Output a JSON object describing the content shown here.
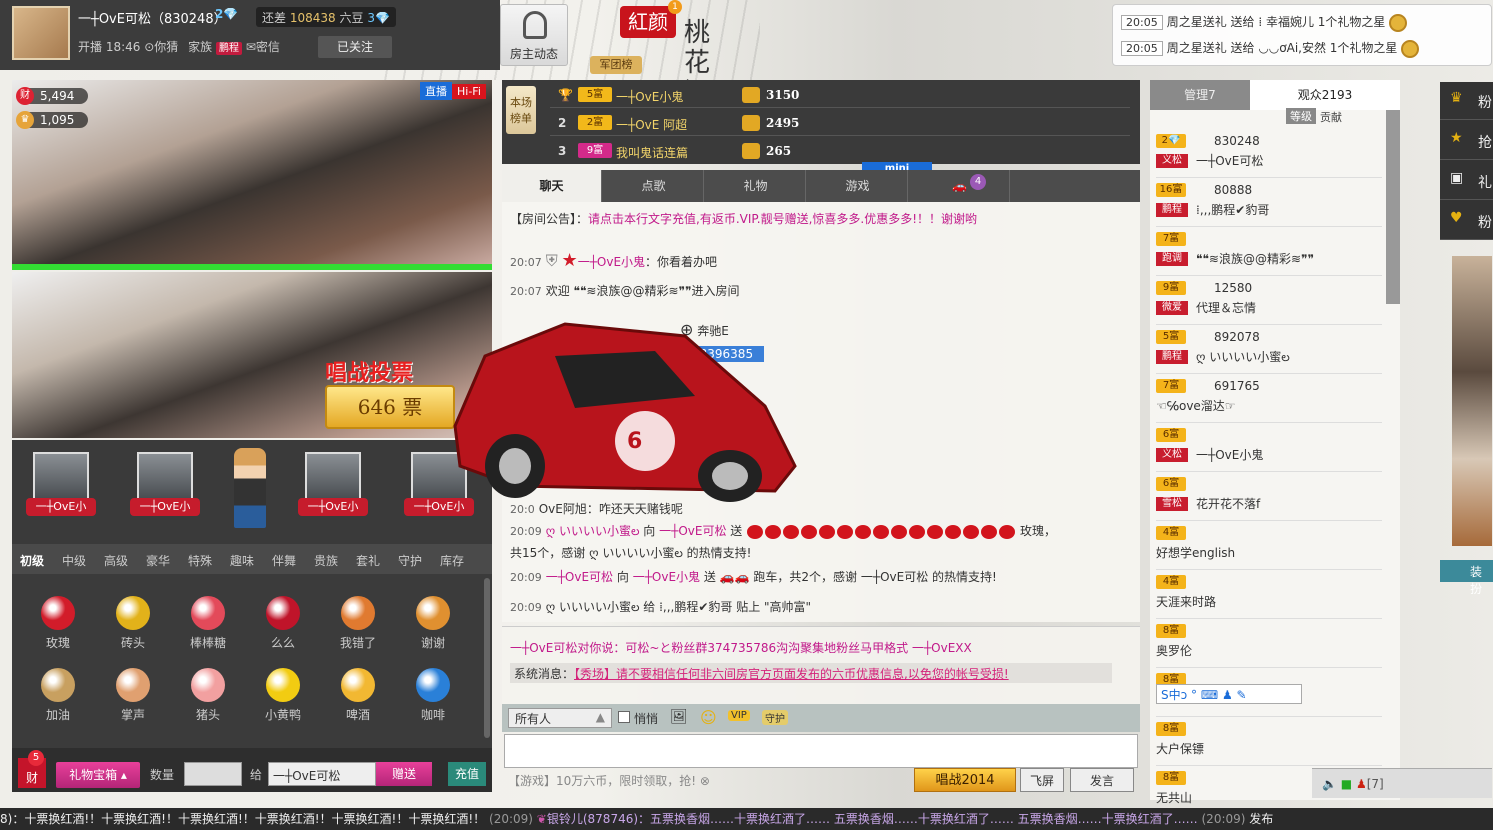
{
  "header": {
    "host_name": "一┼OvE可松（830248）",
    "host_level": "2💎",
    "diff_label": "还差",
    "diff_value": "108438",
    "diff_unit": "六豆",
    "diff_level": "3💎",
    "start_label": "开播 18:46",
    "location": "你猜",
    "family_label": "家族",
    "family_tag": "鹏程",
    "private_msg": "密信",
    "followed": "已关注",
    "host_dynamic": "房主动态",
    "red_logo": "紅颜",
    "red_logo_badge": "1",
    "army_label": "军团榜",
    "brand_text": "桃花源"
  },
  "notify": [
    {
      "time": "20:05",
      "text": "周之星送礼 送给 ⁞ 幸福婉儿 1个礼物之星"
    },
    {
      "time": "20:05",
      "text": "周之星送礼 送给 ◡◡ơAi,安然 1个礼物之星"
    }
  ],
  "video": {
    "wealth": "5,494",
    "wealth_icon": "财",
    "fans": "1,095",
    "live": "直播",
    "hifi": "Hi-Fi",
    "vote_title": "唱战投票",
    "vote_count": "646 票"
  },
  "seats": [
    "一┼OvE小",
    "一┼OvE小",
    "一┼OvE小",
    "一┼OvE小"
  ],
  "gift_tabs": [
    "初级",
    "中级",
    "高级",
    "豪华",
    "特殊",
    "趣味",
    "伴舞",
    "贵族",
    "套礼",
    "守护",
    "库存"
  ],
  "gifts": [
    {
      "name": "玫瑰",
      "color": "#d21c2a"
    },
    {
      "name": "砖头",
      "color": "#e2b21a"
    },
    {
      "name": "棒棒糖",
      "color": "#e34a5a"
    },
    {
      "name": "么么",
      "color": "#c0142a"
    },
    {
      "name": "我错了",
      "color": "#e07a30"
    },
    {
      "name": "谢谢",
      "color": "#e09030"
    },
    {
      "name": "加油",
      "color": "#c8a060"
    },
    {
      "name": "掌声",
      "color": "#e0a070"
    },
    {
      "name": "猪头",
      "color": "#f2a0a0"
    },
    {
      "name": "小黄鸭",
      "color": "#f2cc12"
    },
    {
      "name": "啤酒",
      "color": "#f2b832"
    },
    {
      "name": "咖啡",
      "color": "#2a80d8"
    }
  ],
  "giftbar": {
    "wealth": "财",
    "wealth_badge": "5",
    "box": "礼物宝箱",
    "qty_label": "数量",
    "to_label": "给",
    "to_value": "一┼OvE可松",
    "send": "赠送",
    "charge": "充值"
  },
  "rank": {
    "label": "本场榜单",
    "rows": [
      {
        "rank": "",
        "level": "5富",
        "name": "一┼OvE小鬼",
        "value": "3150"
      },
      {
        "rank": "2",
        "level": "2富",
        "name": "一┼OvE 阿超",
        "value": "2495"
      },
      {
        "rank": "3",
        "level": "9富",
        "name": "我叫鬼话连篇",
        "value": "265"
      }
    ]
  },
  "chat_tabs": [
    "聊天",
    "点歌",
    "礼物",
    "游戏",
    "🚗"
  ],
  "tab_badge": "4",
  "mini": "mini",
  "chat": {
    "notice_label": "【房间公告】：",
    "notice": "请点击本行文字充值,有返币.VIP.靓号赠送,惊喜多多.优惠多多!！！谢谢哟",
    "l1_time": "20:07",
    "l1_name": "一┼OvE小鬼",
    "l1_text": "：你看着办吧",
    "l2_time": "20:07",
    "l2_text": "欢迎 ❝❝≋浪族@@精彩≋❞❞进入房间",
    "l3_text": "奔驰E",
    "l3_id": "53396385",
    "l4_time": "20:0",
    "l4_text": "OvE阿旭：咋还天天赌钱呢",
    "l5_time": "20:09",
    "l5_from": "ღ いいいい小蜜ల",
    "l5_mid": " 向 ",
    "l5_to": "一┼OvE可松",
    "l5_send": " 送 ",
    "l5_tail": "玫瑰，",
    "l5b": "共15个，感谢 ღ いいいい小蜜ల 的热情支持!",
    "l6_time": "20:09",
    "l6_from": "一┼OvE可松",
    "l6_to": "一┼OvE小鬼",
    "l6_tail": "跑车，共2个，感谢 一┼OvE可松 的热情支持!",
    "l7_time": "20:09",
    "l7_text": "ღ いいいい小蜜ల 给 ⁞,,,鹏程✔豹哥 贴上 \"高帅富\""
  },
  "chat_bottom": {
    "private": "一┼OvE可松对你说：可松~と粉丝群374735786沟沟聚集地粉丝马甲格式 一┼OvEXX",
    "sys_label": "系统消息：",
    "sys_text": "【秀场】请不要相信任何非六间房官方页面发布的六币优惠信息,以免您的帐号受损!"
  },
  "input": {
    "target": "所有人",
    "quiet": "悄悄",
    "vip": "VIP",
    "guard": "守护",
    "promo": "【游戏】10万六币，限时领取，抢!",
    "sing": "唱战2014",
    "fly": "飞屏",
    "send": "发言"
  },
  "ulist": {
    "tab_admin": "管理7",
    "tab_audience": "观众2193",
    "level": "等级",
    "contrib": "贡献",
    "users": [
      {
        "level": "2💎",
        "id": "830248",
        "role": "义松",
        "nick": "一┼OvE可松"
      },
      {
        "level": "16富",
        "id": "80888",
        "role": "鹏程",
        "nick": "⁞,,,鹏程✔豹哥"
      },
      {
        "level": "7富",
        "id": "",
        "role": "跑调",
        "nick": "❝❝≋浪族@@精彩≋❞❞"
      },
      {
        "level": "9富",
        "id": "12580",
        "role": "微爱",
        "nick": "代理＆忘情"
      },
      {
        "level": "5富",
        "id": "892078",
        "role": "鹏程",
        "nick": "ღ いいいい小蜜ల"
      },
      {
        "level": "7富",
        "id": "691765",
        "role": "",
        "nick": "☜℅ove溜达☞"
      },
      {
        "level": "6富",
        "id": "",
        "role": "义松",
        "nick": "一┼OvE小鬼"
      },
      {
        "level": "6富",
        "id": "",
        "role": "雪松",
        "nick": "花开花不落f"
      },
      {
        "level": "4富",
        "id": "",
        "role": "",
        "nick": "好想学english"
      },
      {
        "level": "4富",
        "id": "",
        "role": "",
        "nick": "天涯来时路"
      },
      {
        "level": "8富",
        "id": "",
        "role": "",
        "nick": "奥罗伦"
      },
      {
        "level": "8富",
        "id": "",
        "role": "",
        "nick": ""
      },
      {
        "level": "8富",
        "id": "",
        "role": "",
        "nick": "大户保镖"
      },
      {
        "level": "8富",
        "id": "",
        "role": "",
        "nick": "无共山"
      }
    ],
    "ime": "S中ↄ ° ⌨ ♟ ✎",
    "bottom": "[7]"
  },
  "farright": [
    "粉",
    "抢",
    "礼",
    "粉"
  ],
  "dressup": "装扮",
  "marquee": {
    "text1": "8)：十票换红酒!！十票换红酒!！十票换红酒!！十票换红酒!！十票换红酒!！十票换红酒!！",
    "time1": "(20:09)",
    "text2": "银铃儿(878746)：五票换香烟……十票换红酒了…… 五票换香烟……十票换红酒了…… 五票换香烟……十票换红酒了……",
    "time2": "(20:09)",
    "tail": "发布"
  }
}
